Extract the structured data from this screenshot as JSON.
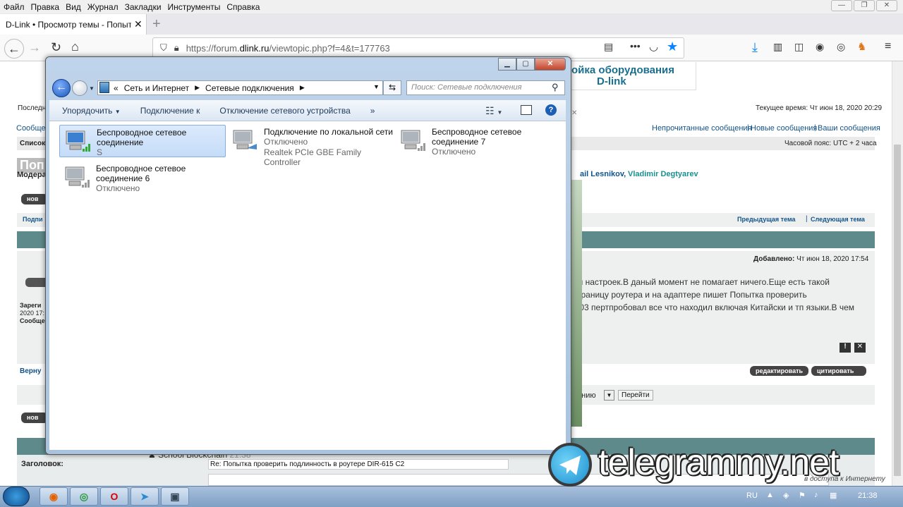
{
  "browser": {
    "menu": [
      "Файл",
      "Правка",
      "Вид",
      "Журнал",
      "Закладки",
      "Инструменты",
      "Справка"
    ],
    "tab_title": "D-Link • Просмотр темы - Попыт",
    "url_prefix": "https://forum.",
    "url_host": "dlink.ru",
    "url_path": "/viewtopic.php?f=4&t=177763"
  },
  "forum": {
    "header_title_line1": "ойка оборудования",
    "header_title_line2": "D-link",
    "last_visit": "Последн",
    "current_time": "Текущее время: Чт июн 18, 2020 20:29",
    "messages_link": "Сообщен",
    "links": [
      "Непрочитанные сообщения",
      "Новые сообщения",
      "Ваши сообщения"
    ],
    "list_label": "Список",
    "timezone": "Часовой пояс: UTC + 2 часа",
    "title_fragment": "Попы",
    "moderators_label": "Модера",
    "moderators_tail": "ail Lesnikov",
    "moderator2": "Vladimir Degtyarev",
    "new_btn": "нов",
    "subscribe_fragment": "Подпи",
    "prev_topic": "Предыдущая тема",
    "next_topic": "Следующая тема",
    "added": "Добавлено:",
    "added_date": "Чт июн 18, 2020 17:54",
    "post_lines": [
      "м настроек.В даный момент не помагает ничего.Еще есть такой",
      "траницу роутера и на адаптере пишет Попытка проверить",
      ".03 пертпробовал все что находил включая Китайски и тп языки.В чем"
    ],
    "registered": "Зареги",
    "reg_date": "2020 17:",
    "posts": "Сообще",
    "return": "Верну",
    "edit_btn": "редактировать",
    "quote_btn": "цитировать",
    "jump_fragment": "анию",
    "go_btn": "Перейти",
    "subject_label": "Заголовок:",
    "subject_value": "Re: Попытка проверить подлинность в роутере DIR-615 C2",
    "blockchain_fragment": "School Blockchain",
    "time_fragment": "21:38",
    "access_fragment": "в доступа к Интернету"
  },
  "explorer": {
    "breadcrumb": [
      "Сеть и Интернет",
      "Сетевые подключения"
    ],
    "search_placeholder": "Поиск: Сетевые подключения",
    "commands": [
      "Упорядочить",
      "Подключение к",
      "Отключение сетевого устройства"
    ],
    "items": [
      {
        "name_line1": "Беспроводное сетевое",
        "name_line2": "соединение",
        "status": "S",
        "icon": "wireless-adapter-icon",
        "selected": true
      },
      {
        "name_line1": "Подключение по локальной сети",
        "name_line2": "",
        "status": "Отключено",
        "device": "Realtek PCIe GBE Family Controller",
        "icon": "ethernet-adapter-icon",
        "selected": false
      },
      {
        "name_line1": "Беспроводное сетевое",
        "name_line2": "соединение 7",
        "status": "Отключено",
        "icon": "wireless-adapter-icon",
        "selected": false
      },
      {
        "name_line1": "Беспроводное сетевое",
        "name_line2": "соединение 6",
        "status": "Отключено",
        "icon": "wireless-adapter-icon",
        "selected": false
      }
    ]
  },
  "watermark": "telegrammy.net",
  "taskbar": {
    "lang": "RU",
    "clock": "21:38"
  },
  "colors": {
    "accent": "#105289",
    "teal": "#5f8a8b",
    "selection": "#c4dcf8"
  }
}
